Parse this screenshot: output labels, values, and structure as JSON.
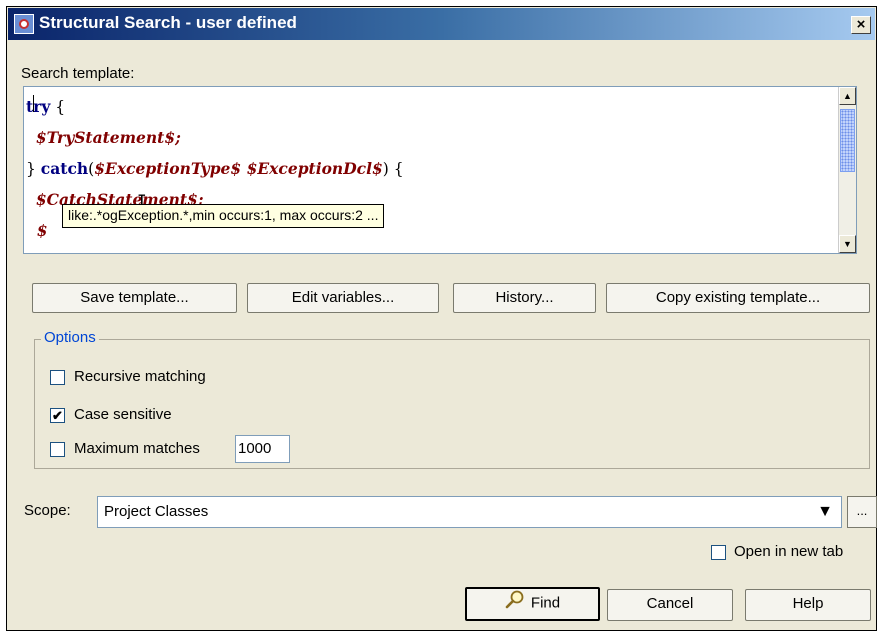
{
  "window": {
    "title": "Structural Search - user defined",
    "close_glyph": "×",
    "icon": "app-icon"
  },
  "search_template": {
    "label": "Search template:",
    "lines": [
      [
        {
          "t": "try",
          "c": "kw"
        },
        {
          "t": " {",
          "c": ""
        }
      ],
      [
        {
          "t": "  ",
          "c": ""
        },
        {
          "t": "$TryStatement$;",
          "c": "var"
        }
      ],
      [
        {
          "t": "} ",
          "c": ""
        },
        {
          "t": "catch",
          "c": "kw"
        },
        {
          "t": "(",
          "c": ""
        },
        {
          "t": "$ExceptionType$ $ExceptionDcl$",
          "c": "var"
        },
        {
          "t": ") {",
          "c": ""
        }
      ],
      [
        {
          "t": "  ",
          "c": ""
        },
        {
          "t": "$CatchStatement$;",
          "c": "var"
        }
      ],
      [
        {
          "t": "  $",
          "c": "var"
        }
      ],
      [
        {
          "t": "}",
          "c": ""
        }
      ]
    ],
    "tooltip": "like:.*ogException.*,min occurs:1, max occurs:2 ..."
  },
  "buttons": {
    "save_template": "Save template...",
    "edit_variables": "Edit variables...",
    "history": "History...",
    "copy_existing": "Copy existing template..."
  },
  "options": {
    "legend": "Options",
    "recursive_matching": {
      "label": "Recursive matching",
      "checked": false
    },
    "case_sensitive": {
      "label": "Case sensitive",
      "checked": true
    },
    "maximum_matches": {
      "label": "Maximum matches",
      "checked": false,
      "value": "1000"
    }
  },
  "scope": {
    "label": "Scope:",
    "value": "Project Classes",
    "more": "..."
  },
  "open_in_new_tab": {
    "label": "Open in new tab",
    "checked": false
  },
  "footer": {
    "find": "Find",
    "cancel": "Cancel",
    "help": "Help"
  },
  "colors": {
    "title_start": "#0a246a",
    "title_end": "#a6caf0",
    "keyword": "#000080",
    "variable": "#800000",
    "dialog_bg": "#ece9d8",
    "tooltip_bg": "#ffffe1"
  },
  "check_glyph": "✔",
  "scroll_up_glyph": "▲",
  "scroll_down_glyph": "▼",
  "combo_arrow_glyph": "▼"
}
